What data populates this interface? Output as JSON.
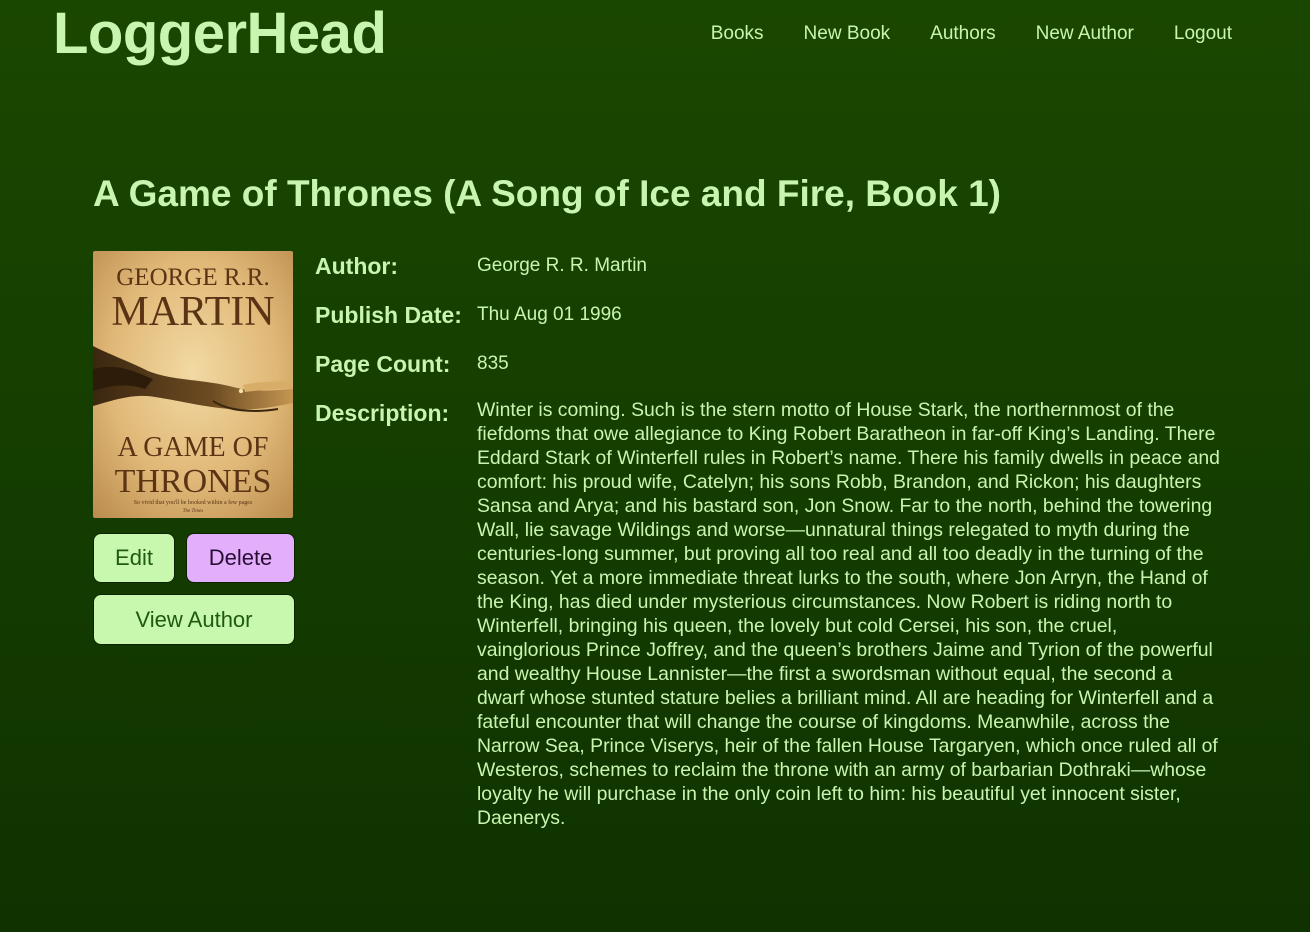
{
  "header": {
    "brand": "LoggerHead",
    "nav": [
      "Books",
      "New Book",
      "Authors",
      "New Author",
      "Logout"
    ]
  },
  "book": {
    "title": "A Game of Thrones (A Song of Ice and Fire, Book 1)",
    "cover": {
      "author_line1": "GEORGE R.R.",
      "author_line2": "MARTIN",
      "title_line1": "A GAME OF",
      "title_line2": "THRONES",
      "tagline": "So vivid that you'll be hooked within a few pages",
      "tagline_source": "The Times"
    },
    "labels": {
      "author": "Author:",
      "publish_date": "Publish Date:",
      "page_count": "Page Count:",
      "description": "Description:"
    },
    "author": "George R. R. Martin",
    "publish_date": "Thu Aug 01 1996",
    "page_count": "835",
    "description": "Winter is coming. Such is the stern motto of House Stark, the northernmost of the fiefdoms that owe allegiance to King Robert Baratheon in far-off King’s Landing. There Eddard Stark of Winterfell rules in Robert’s name. There his family dwells in peace and comfort: his proud wife, Catelyn; his sons Robb, Brandon, and Rickon; his daughters Sansa and Arya; and his bastard son, Jon Snow. Far to the north, behind the towering Wall, lie savage Wildings and worse—unnatural things relegated to myth during the centuries-long summer, but proving all too real and all too deadly in the turning of the season. Yet a more immediate threat lurks to the south, where Jon Arryn, the Hand of the King, has died under mysterious circumstances. Now Robert is riding north to Winterfell, bringing his queen, the lovely but cold Cersei, his son, the cruel, vainglorious Prince Joffrey, and the queen’s brothers Jaime and Tyrion of the powerful and wealthy House Lannister—the first a swordsman without equal, the second a dwarf whose stunted stature belies a brilliant mind. All are heading for Winterfell and a fateful encounter that will change the course of kingdoms. Meanwhile, across the Narrow Sea, Prince Viserys, heir of the fallen House Targaryen, which once ruled all of Westeros, schemes to reclaim the throne with an army of barbarian Dothraki—whose loyalty he will purchase in the only coin left to him: his beautiful yet innocent sister, Daenerys."
  },
  "actions": {
    "edit": "Edit",
    "delete": "Delete",
    "view_author": "View Author"
  },
  "colors": {
    "background": "#154200",
    "text": "#c8f5b0",
    "button_green": "#c7f8ad",
    "button_purple": "#e3aefc"
  }
}
